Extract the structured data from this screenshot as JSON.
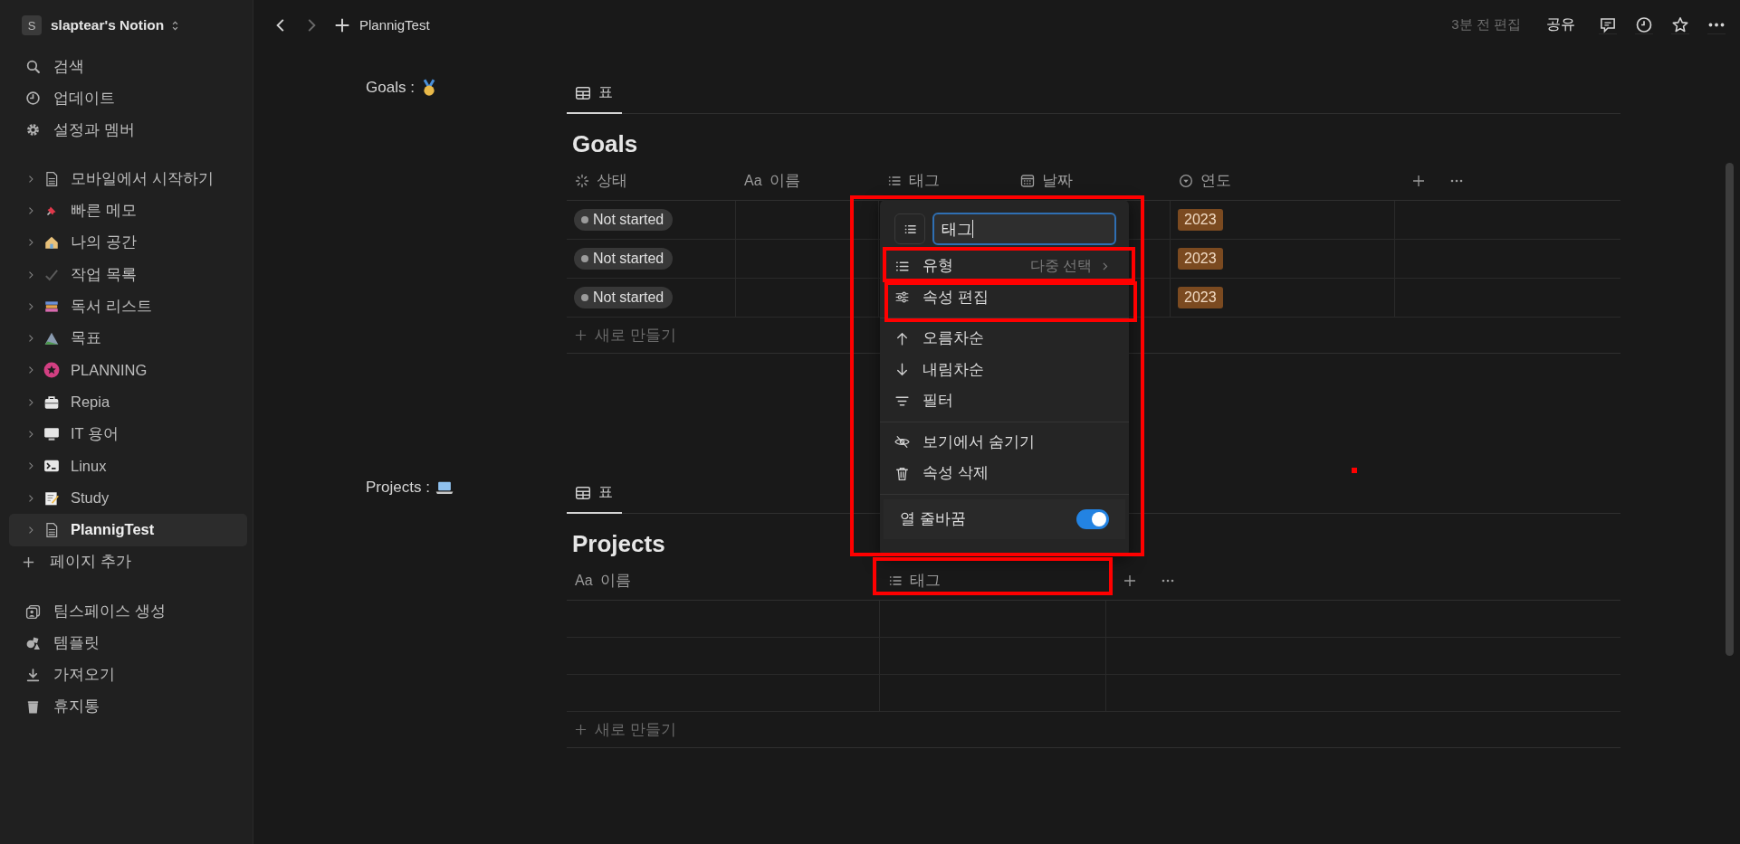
{
  "sidebar": {
    "workspace_initial": "S",
    "workspace": "slaptear's Notion",
    "nav": [
      {
        "label": "검색"
      },
      {
        "label": "업데이트"
      },
      {
        "label": "설정과 멤버"
      }
    ],
    "pages": [
      {
        "label": "모바일에서 시작하기",
        "selected": false
      },
      {
        "label": "빠른 메모",
        "selected": false
      },
      {
        "label": "나의 공간",
        "selected": false
      },
      {
        "label": "작업 목록",
        "selected": false
      },
      {
        "label": "독서 리스트",
        "selected": false
      },
      {
        "label": "목표",
        "selected": false
      },
      {
        "label": "PLANNING",
        "selected": false
      },
      {
        "label": "Repia",
        "selected": false
      },
      {
        "label": "IT 용어",
        "selected": false
      },
      {
        "label": "Linux",
        "selected": false
      },
      {
        "label": "Study",
        "selected": false
      },
      {
        "label": "PlannigTest",
        "selected": true
      }
    ],
    "add_page": "페이지 추가",
    "footer": [
      {
        "label": "팀스페이스 생성"
      },
      {
        "label": "템플릿"
      },
      {
        "label": "가져오기"
      },
      {
        "label": "휴지통"
      }
    ]
  },
  "topbar": {
    "page": "PlannigTest",
    "edited": "3분 전 편집",
    "share": "공유"
  },
  "goals": {
    "label": "Goals :",
    "view_tab": "표",
    "title": "Goals",
    "columns": [
      {
        "label": "상태"
      },
      {
        "type_glyph": "Aa",
        "label": "이름"
      },
      {
        "label": "태그"
      },
      {
        "label": "날짜"
      },
      {
        "label": "연도"
      }
    ],
    "rows": [
      {
        "status": "Not started",
        "year": "2023"
      },
      {
        "status": "Not started",
        "year": "2023"
      },
      {
        "status": "Not started",
        "year": "2023"
      }
    ],
    "new_row": "새로 만들기"
  },
  "projects": {
    "label": "Projects :",
    "view_tab": "표",
    "title": "Projects",
    "columns": [
      {
        "type_glyph": "Aa",
        "label": "이름"
      },
      {
        "label": "태그"
      }
    ],
    "new_row": "새로 만들기"
  },
  "menu": {
    "name_value": "태그",
    "groups": [
      [
        {
          "kind": "type",
          "label": "유형",
          "value": "다중 선택"
        },
        {
          "kind": "item",
          "label": "속성 편집"
        }
      ],
      [
        {
          "kind": "item",
          "label": "오름차순"
        },
        {
          "kind": "item",
          "label": "내림차순"
        },
        {
          "kind": "item",
          "label": "필터"
        }
      ],
      [
        {
          "kind": "item",
          "label": "보기에서 숨기기"
        },
        {
          "kind": "item",
          "label": "속성 삭제"
        }
      ],
      [
        {
          "kind": "toggle",
          "label": "열 줄바꿈",
          "on": true
        }
      ]
    ]
  }
}
